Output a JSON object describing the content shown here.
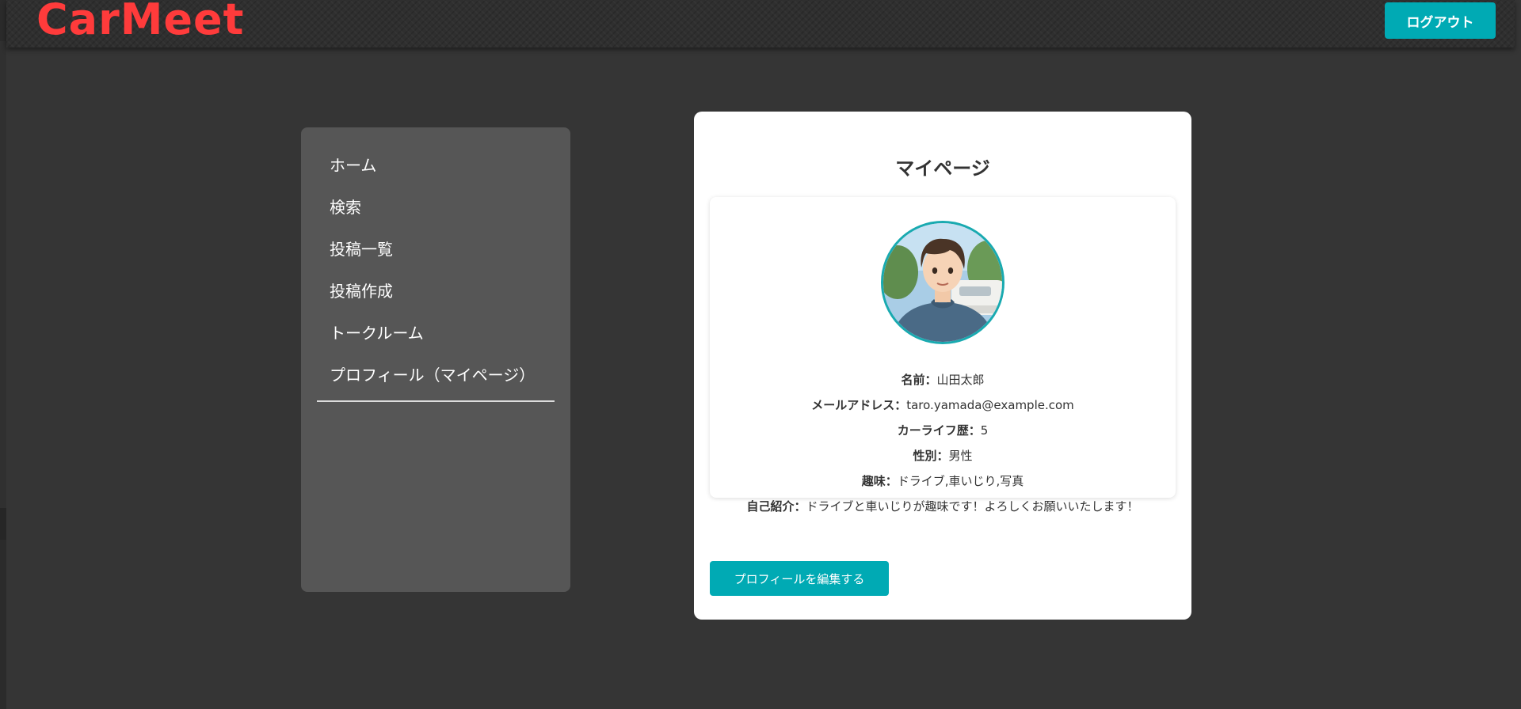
{
  "header": {
    "logo": "CarMeet",
    "logout_label": "ログアウト"
  },
  "sidebar": {
    "items": [
      {
        "label": "ホーム"
      },
      {
        "label": "検索"
      },
      {
        "label": "投稿一覧"
      },
      {
        "label": "投稿作成"
      },
      {
        "label": "トークルーム"
      },
      {
        "label": "プロフィール（マイページ）"
      }
    ]
  },
  "main": {
    "title": "マイページ",
    "profile": {
      "name_label": "名前：",
      "name": "山田太郎",
      "email_label": "メールアドレス：",
      "email": "taro.yamada@example.com",
      "career_label": "カーライフ歴：",
      "career": "5",
      "gender_label": "性別：",
      "gender": "男性",
      "hobby_label": "趣味：",
      "hobby": "ドライブ,車いじり,写真",
      "intro_label": "自己紹介：",
      "intro": "ドライブと車いじりが趣味です！よろしくお願いいたします！"
    },
    "edit_label": "プロフィールを編集する"
  },
  "colors": {
    "background": "#353535",
    "logo": "#ff3b3b",
    "accent": "#00aab4",
    "sidebar": "#565656",
    "card": "#ffffff"
  },
  "icons": {
    "avatar": "user-avatar-photo"
  }
}
